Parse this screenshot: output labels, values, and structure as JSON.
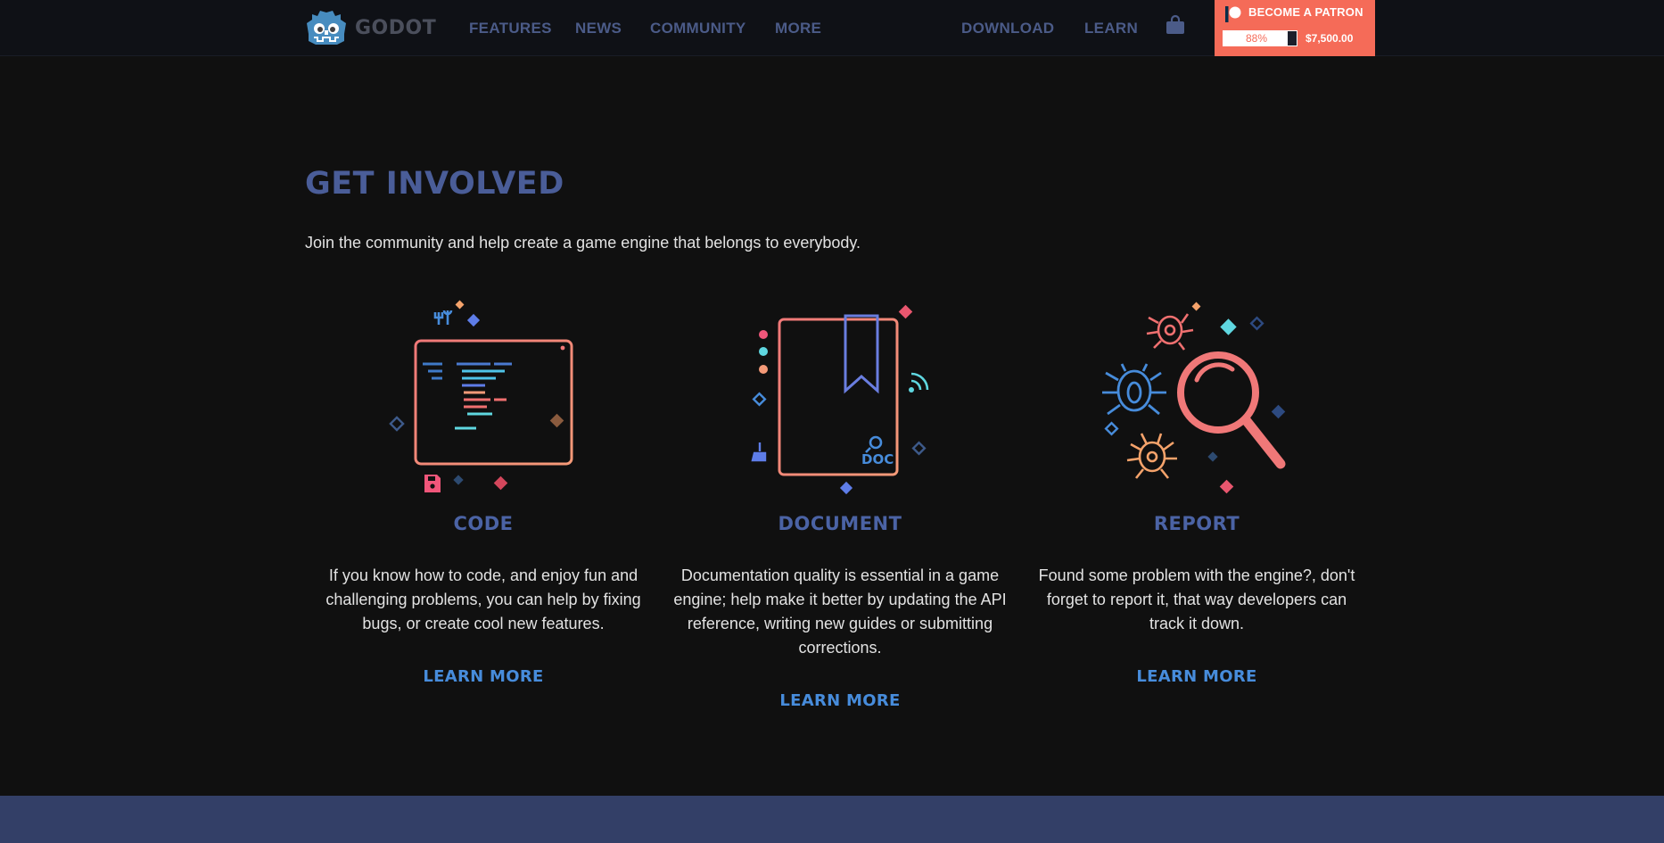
{
  "brand": {
    "name": "GODOT"
  },
  "nav": {
    "features": "FEATURES",
    "news": "NEWS",
    "community": "COMMUNITY",
    "more": "MORE",
    "download": "DOWNLOAD",
    "learn": "LEARN"
  },
  "patron": {
    "label": "BECOME A PATRON",
    "percent": "88%",
    "progress_fraction": 0.88,
    "amount": "$7,500.00"
  },
  "hero": {
    "title": "GET INVOLVED",
    "subtitle": "Join the community and help create a game engine that belongs to everybody."
  },
  "cards": [
    {
      "title": "CODE",
      "text": "If you know how to code, and enjoy fun and challenging problems, you can help by fixing bugs, or create cool new features.",
      "link": "LEARN MORE",
      "icon": "code-editor-icon"
    },
    {
      "title": "DOCUMENT",
      "text": "Documentation quality is essential in a game engine; help make it better by updating the API reference, writing new guides or submitting corrections.",
      "link": "LEARN MORE",
      "icon": "doc-book-icon",
      "badge": "DOC"
    },
    {
      "title": "REPORT",
      "text": "Found some problem with the engine?, don't forget to report it, that way developers can track it down.",
      "link": "LEARN MORE",
      "icon": "bug-search-icon"
    }
  ],
  "colors": {
    "nav_bg": "#0f1116",
    "page_bg": "#101010",
    "accent_blue": "#478cdb",
    "title_blue": "#4a5d98",
    "patron_bg": "#f56b58",
    "footer_band": "#333f67"
  }
}
